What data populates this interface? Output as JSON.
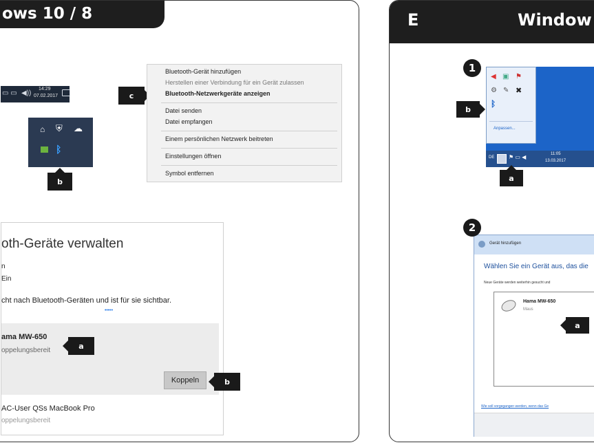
{
  "left_panel": {
    "header_title": "ows 10 / 8",
    "taskbar": {
      "time": "14:29",
      "date": "07.02.2017",
      "wifi_label": "◻))"
    },
    "label_b_tray": "b",
    "label_c": "c",
    "context_menu": {
      "items": [
        "Bluetooth-Gerät hinzufügen",
        "Herstellen einer Verbindung für ein Gerät zulassen",
        "Bluetooth-Netzwerkgeräte anzeigen",
        "Datei senden",
        "Datei empfangen",
        "Einem persönlichen Netzwerk beitreten",
        "Einstellungen öffnen",
        "Symbol entfernen"
      ]
    },
    "bt_window": {
      "title": "oth-Geräte verwalten",
      "line1": "n",
      "line2": "Ein",
      "search_text": "cht nach Bluetooth-Geräten und ist für sie sichtbar.",
      "progress_dots": "• • • • •",
      "device1_name": "ama MW-650",
      "device1_status": "oppelungsbereit",
      "pair_button": "Koppeln",
      "device2_name": "AC-User QSs MacBook Pro",
      "device2_status": "oppelungsbereit"
    },
    "label_a": "a",
    "label_b": "b"
  },
  "right_panel": {
    "letter": "E",
    "header_title": "Window",
    "step1": "1",
    "step2": "2",
    "tray_popup_link": "Anpassen...",
    "taskbar": {
      "lang": "DE",
      "time": "11:05",
      "date": "13.03.2017"
    },
    "label_b": "b",
    "label_a": "a",
    "wizard": {
      "title_bar": "Gerät hinzufügen",
      "heading": "Wählen Sie ein Gerät aus, das die",
      "subtext": "Neue Geräte werden weiterhin gesucht und",
      "device_name": "Hama MW-650",
      "device_type": "Maus",
      "label_a": "a",
      "footer_link": "Wie soll vorgegangen werden, wenn das Ge"
    }
  },
  "colors": {
    "header": "#1e1e1e",
    "win7_blue": "#1c64c8",
    "win10_taskbar": "#1f2a3a",
    "pair_button": "#c8c8c8"
  }
}
